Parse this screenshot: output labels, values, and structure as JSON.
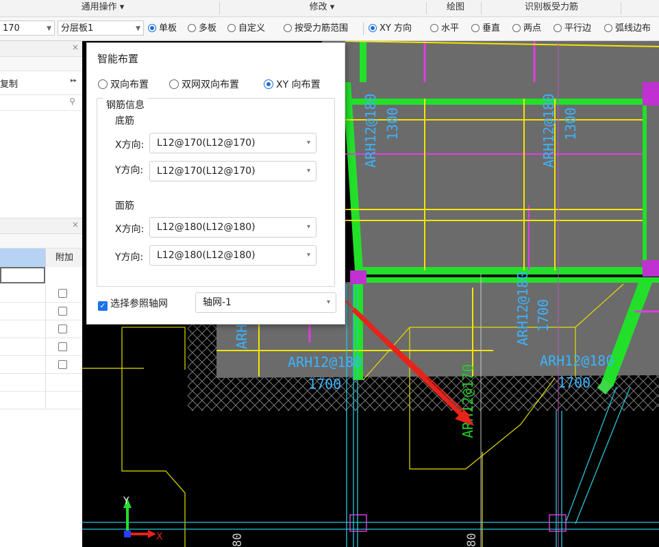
{
  "ribbon": {
    "groups": [
      "通用操作 ▾",
      "修改 ▾",
      "绘图",
      "识别板受力筋"
    ]
  },
  "toolbar": {
    "spacing_value": "170",
    "layer_value": "分层板1",
    "layer_arrow": "▾",
    "scope_options": [
      {
        "label": "单板",
        "selected": true
      },
      {
        "label": "多板",
        "selected": false
      },
      {
        "label": "自定义",
        "selected": false
      },
      {
        "label": "按受力筋范围",
        "selected": false
      }
    ],
    "direction_options": [
      {
        "label": "XY 方向",
        "selected": true
      },
      {
        "label": "水平",
        "selected": false
      },
      {
        "label": "垂直",
        "selected": false
      },
      {
        "label": "两点",
        "selected": false
      },
      {
        "label": "平行边",
        "selected": false
      },
      {
        "label": "弧线边布",
        "selected": false
      }
    ]
  },
  "left_panel": {
    "copy_label": "复制",
    "expand_glyph": "▸▸",
    "close_glyph": "×",
    "search_glyph": "⚲",
    "attach_header": "附加",
    "checkbox_rows": 5
  },
  "dialog": {
    "title": "智能布置",
    "layout_options": [
      {
        "label": "双向布置",
        "selected": false
      },
      {
        "label": "双网双向布置",
        "selected": false
      },
      {
        "label": "XY 向布置",
        "selected": true
      }
    ],
    "rebar_info_label": "钢筋信息",
    "bottom_label": "底筋",
    "top_label": "面筋",
    "x_label": "X方向:",
    "y_label": "Y方向:",
    "bottom_x": "L12@170(L12@170)",
    "bottom_y": "L12@170(L12@170)",
    "top_x": "L12@180(L12@180)",
    "top_y": "L12@180(L12@180)",
    "ref_grid_checked": true,
    "ref_grid_label": "选择参照轴网",
    "grid_value": "轴网-1"
  },
  "canvas": {
    "annotations": [
      "ARH12@180",
      "1300",
      "ARH12@180",
      "1300",
      "ARH12@180",
      "1700",
      "ARH12@180",
      "1700",
      "ARH12@180",
      "1700",
      "ARH12@170",
      "ARH"
    ],
    "axis_y": "Y",
    "axis_x": "X",
    "bottom_labels": [
      "80",
      "80"
    ]
  },
  "colors": {
    "slab_fill": "#6b6b6b",
    "beam_green": "#22e02a",
    "rebar_yellow": "#f2e600",
    "rebar_magenta": "#e23ce0",
    "axis_cyan": "#28c8dc",
    "label_cyan": "#3ab4ff",
    "arrow_red": "#e8231a",
    "selection_blue": "#1a6fd6"
  }
}
